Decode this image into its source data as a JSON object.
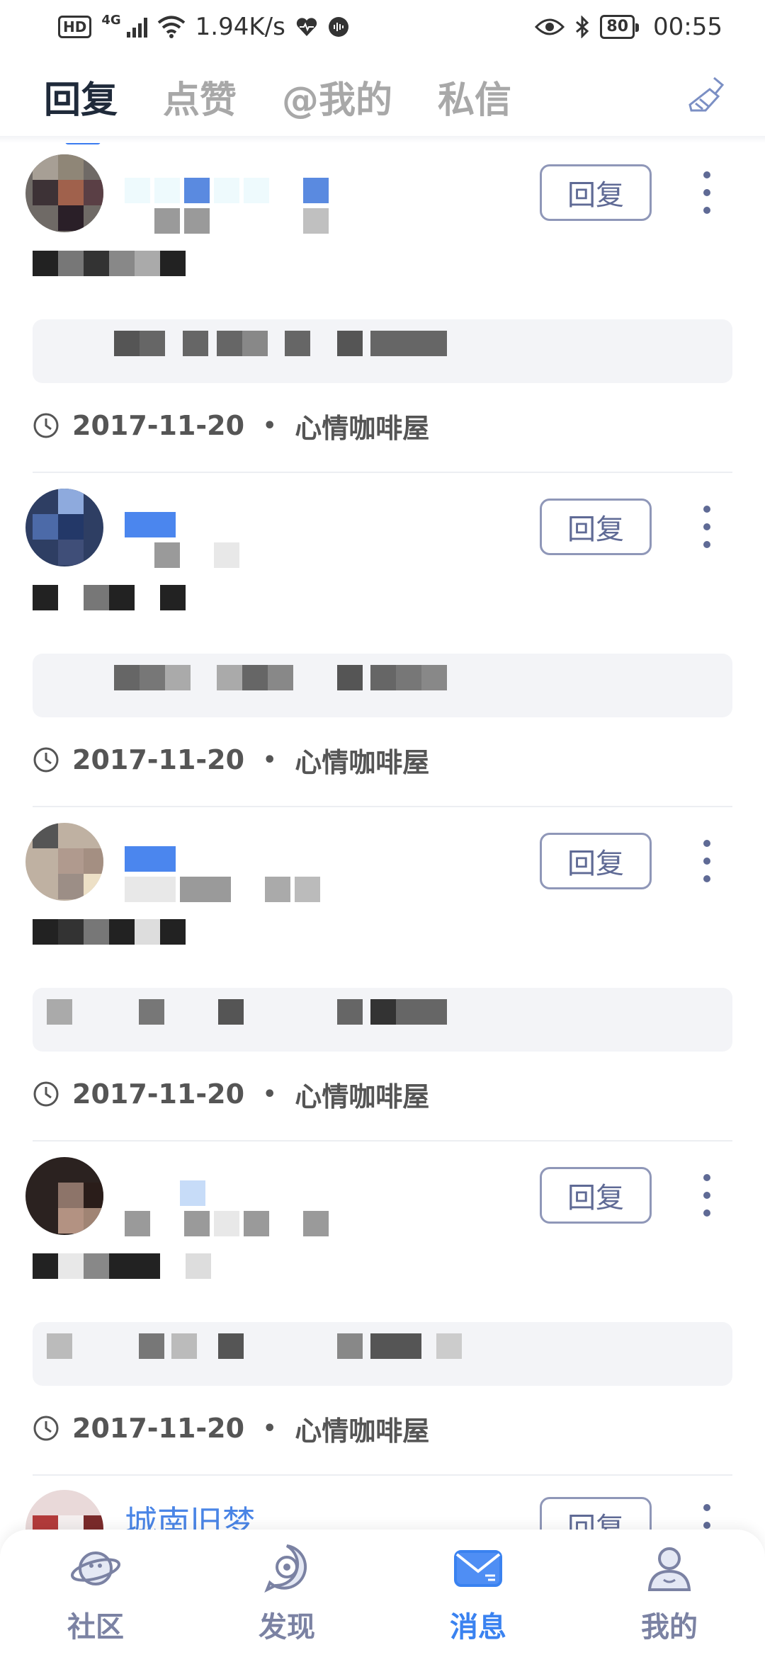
{
  "status_bar": {
    "hd": "HD",
    "network": "4G",
    "speed": "1.94K/s",
    "battery": "80",
    "time": "00:55"
  },
  "tabs": [
    {
      "label": "回复",
      "active": true
    },
    {
      "label": "点赞",
      "active": false
    },
    {
      "label": "@我的",
      "active": false
    },
    {
      "label": "私信",
      "active": false
    }
  ],
  "reply_label": "回复",
  "cards": [
    {
      "date": "2017-11-20",
      "group": "心情咖啡屋"
    },
    {
      "date": "2017-11-20",
      "group": "心情咖啡屋"
    },
    {
      "date": "2017-11-20",
      "group": "心情咖啡屋"
    },
    {
      "date": "2017-11-20",
      "group": "心情咖啡屋"
    }
  ],
  "partial_card": {
    "name": "城南旧梦"
  },
  "separator": "•",
  "bottom_nav": [
    {
      "label": "社区",
      "icon": "planet-icon",
      "active": false
    },
    {
      "label": "发现",
      "icon": "discover-icon",
      "active": false
    },
    {
      "label": "消息",
      "icon": "mail-icon",
      "active": true
    },
    {
      "label": "我的",
      "icon": "profile-icon",
      "active": false
    }
  ],
  "colors": {
    "accent": "#3a82f0",
    "reply_border": "#8f97b8",
    "nav_inactive": "#7b82a3"
  }
}
